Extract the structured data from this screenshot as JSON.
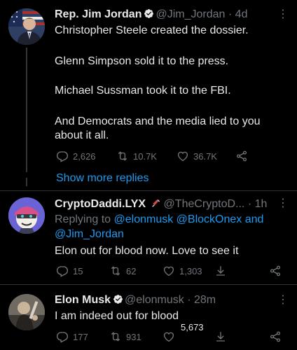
{
  "tweets": [
    {
      "name": "Rep. Jim Jordan",
      "handle": "@Jim_Jordan",
      "time": "· 4d",
      "lines": [
        "Christopher Steele created the dossier.",
        "Glenn Simpson sold it to the press.",
        "Michael Sussman took it to the FBI.",
        "And Democrats and the media lied to you",
        "about it all."
      ],
      "replies": "2,626",
      "retweets": "10.7K",
      "likes": "36.7K"
    },
    {
      "name": "CryptoDaddi.LYX",
      "handle": "@TheCryptoD...",
      "time": "· 1h",
      "replying_prefix": "Replying to ",
      "replying_1": "@elonmusk",
      "replying_2": "@BlockOnex",
      "replying_and": " and",
      "replying_3": "@Jim_Jordan",
      "text": "Elon out for blood now. Love to see it",
      "replies": "15",
      "retweets": "62",
      "likes": "1,303"
    },
    {
      "name": "Elon Musk",
      "handle": "@elonmusk",
      "time": "· 28m",
      "text": "I am indeed out for blood",
      "replies": "177",
      "retweets": "931",
      "likes": "5,673"
    }
  ],
  "show_more": "Show more replies",
  "more_glyph": "⋮",
  "colors": {
    "accent": "#1d9bf0",
    "muted": "#71767b",
    "text": "#e7e9ea"
  },
  "icons": [
    "reply-icon",
    "retweet-icon",
    "like-icon",
    "share-icon",
    "verified-icon",
    "more-icon"
  ]
}
